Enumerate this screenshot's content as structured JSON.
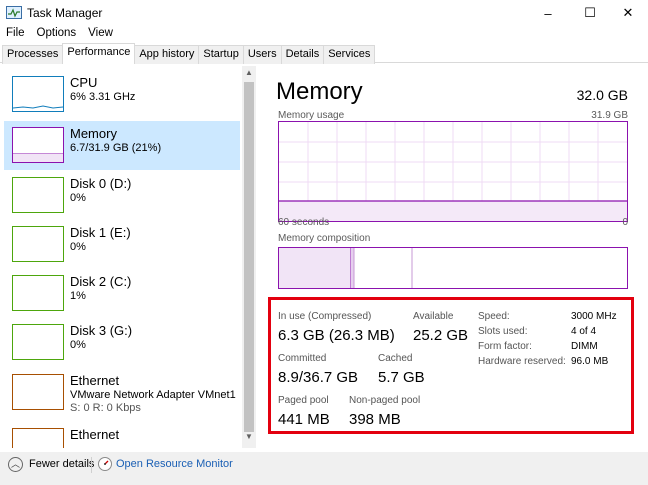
{
  "window": {
    "title": "Task Manager",
    "controls": [
      "–",
      "☐",
      "✕"
    ]
  },
  "menu": [
    "File",
    "Options",
    "View"
  ],
  "tabs": [
    "Processes",
    "Performance",
    "App history",
    "Startup",
    "Users",
    "Details",
    "Services"
  ],
  "active_tab": 1,
  "sidebar": [
    {
      "name": "CPU",
      "sub": "6% 3.31 GHz",
      "color": "#117dbb"
    },
    {
      "name": "Memory",
      "sub": "6.7/31.9 GB (21%)",
      "color": "#8b12ae"
    },
    {
      "name": "Disk 0 (D:)",
      "sub": "0%",
      "color": "#4da60c"
    },
    {
      "name": "Disk 1 (E:)",
      "sub": "0%",
      "color": "#4da60c"
    },
    {
      "name": "Disk 2 (C:)",
      "sub": "1%",
      "color": "#4da60c"
    },
    {
      "name": "Disk 3 (G:)",
      "sub": "0%",
      "color": "#4da60c"
    },
    {
      "name": "Ethernet",
      "sub": "VMware Network Adapter VMnet1",
      "sub2": "S: 0 R: 0 Kbps",
      "color": "#a74f01"
    },
    {
      "name": "Ethernet",
      "sub": "",
      "color": "#a74f01"
    }
  ],
  "main": {
    "title": "Memory",
    "total": "32.0 GB",
    "usage_label": "Memory usage",
    "usage_max": "31.9 GB",
    "time_label": "60 seconds",
    "time_zero": "0",
    "composition_label": "Memory composition",
    "accent": "#8b12ae"
  },
  "stats": {
    "in_use_label": "In use (Compressed)",
    "in_use_value": "6.3 GB (26.3 MB)",
    "available_label": "Available",
    "available_value": "25.2 GB",
    "committed_label": "Committed",
    "committed_value": "8.9/36.7 GB",
    "cached_label": "Cached",
    "cached_value": "5.7 GB",
    "paged_label": "Paged pool",
    "paged_value": "441 MB",
    "nonpaged_label": "Non-paged pool",
    "nonpaged_value": "398 MB",
    "kv": [
      {
        "label": "Speed:",
        "value": "3000 MHz"
      },
      {
        "label": "Slots used:",
        "value": "4 of 4"
      },
      {
        "label": "Form factor:",
        "value": "DIMM"
      },
      {
        "label": "Hardware reserved:",
        "value": "96.0 MB"
      }
    ]
  },
  "footer": {
    "fewer": "Fewer details",
    "resmon": "Open Resource Monitor"
  },
  "highlight_color": "#e3000f"
}
